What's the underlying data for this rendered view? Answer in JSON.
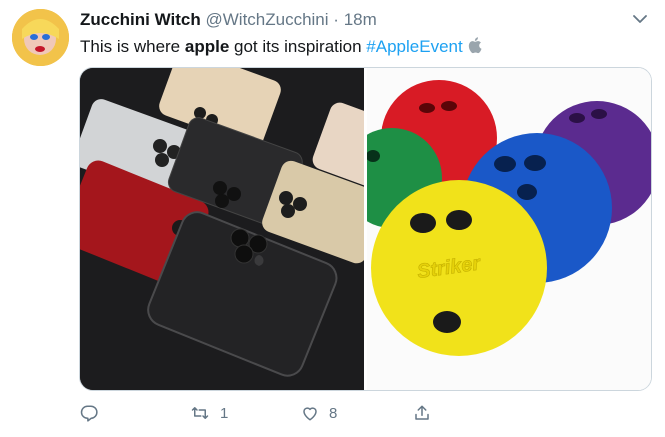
{
  "tweet": {
    "display_name": "Zucchini Witch",
    "handle": "@WitchZucchini",
    "separator": "·",
    "time": "18m",
    "text_before": "This is where ",
    "text_bold": "apple",
    "text_after": " got its inspiration ",
    "hashtag": "#AppleEvent"
  },
  "actions": {
    "reply_icon": "reply-icon",
    "retweet_icon": "retweet-icon",
    "retweet_count": "1",
    "like_icon": "heart-icon",
    "like_count": "8",
    "share_icon": "share-icon"
  },
  "colors": {
    "link": "#1da1f2",
    "muted": "#657786",
    "border": "#ccd6dd"
  }
}
